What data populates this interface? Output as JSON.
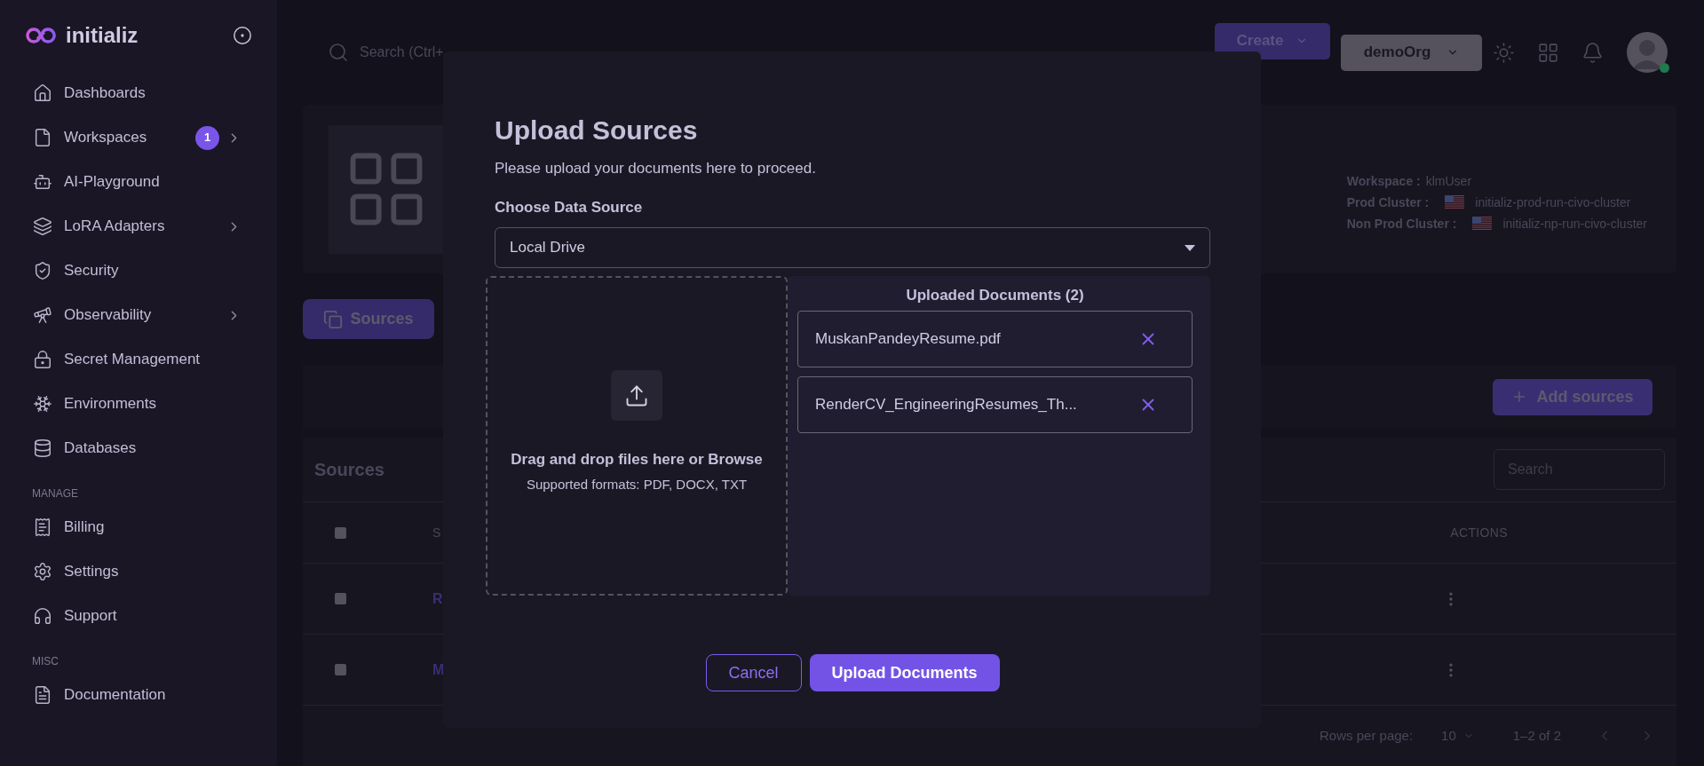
{
  "sidebar": {
    "brand": "initializ",
    "items": [
      {
        "label": "Dashboards",
        "submenu": false
      },
      {
        "label": "Workspaces",
        "badge": "1",
        "submenu": true
      },
      {
        "label": "AI-Playground",
        "submenu": false
      },
      {
        "label": "LoRA Adapters",
        "submenu": true
      },
      {
        "label": "Security",
        "submenu": false
      },
      {
        "label": "Observability",
        "submenu": true
      },
      {
        "label": "Secret Management",
        "submenu": false
      },
      {
        "label": "Environments",
        "submenu": false
      },
      {
        "label": "Databases",
        "submenu": false
      }
    ],
    "sections": [
      {
        "title": "MANAGE",
        "items": [
          {
            "label": "Billing",
            "submenu": false
          },
          {
            "label": "Settings",
            "submenu": false
          },
          {
            "label": "Support",
            "submenu": false
          }
        ]
      },
      {
        "title": "MISC",
        "items": [
          {
            "label": "Documentation",
            "submenu": false
          }
        ]
      }
    ]
  },
  "header": {
    "search_placeholder": "Search (Ctrl+",
    "create": "Create",
    "org": "demoOrg",
    "avatar_online": true
  },
  "workspace_info": [
    {
      "label": "Workspace :",
      "value": "klmUser",
      "flag": false
    },
    {
      "label": "Prod Cluster :",
      "value": "initializ-prod-run-civo-cluster",
      "flag": true
    },
    {
      "label": "Non Prod Cluster :",
      "value": "initializ-np-run-civo-cluster",
      "flag": true
    }
  ],
  "tabs": [
    {
      "label": "Sources",
      "selected": true
    }
  ],
  "add_button": "Add sources",
  "table": {
    "title": "Sources",
    "search_placeholder": "Search",
    "all_checked": false,
    "columns": [
      "S",
      "ACTIONS"
    ],
    "rows": [
      {
        "name": "R",
        "checked": false
      },
      {
        "name": "M",
        "checked": false
      }
    ],
    "rows_per_page_label": "Rows per page:",
    "rows_per_page": "10",
    "range": "1–2 of 2"
  },
  "modal": {
    "title": "Upload Sources",
    "subtitle": "Please upload your documents here to proceed.",
    "source_label": "Choose Data Source",
    "source": "Local Drive",
    "drop_text": "Drag and drop files here or Browse",
    "formats": "Supported formats: PDF, DOCX, TXT",
    "uploaded_heading": "Uploaded Documents (2)",
    "files": [
      "MuskanPandeyResume.pdf",
      "RenderCV_EngineeringResumes_Th..."
    ],
    "cancel": "Cancel",
    "submit": "Upload Documents"
  }
}
